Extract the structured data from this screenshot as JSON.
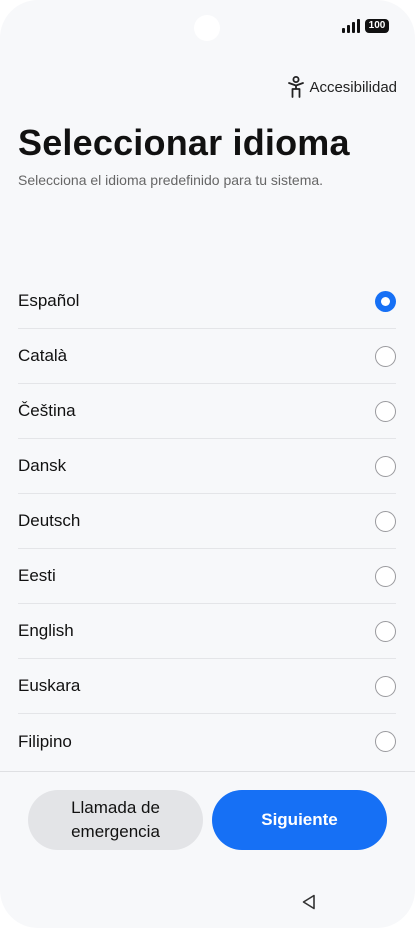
{
  "status_bar": {
    "battery_label": "100",
    "icons": [
      "camera-cutout",
      "signal-icon",
      "battery-icon"
    ]
  },
  "header": {
    "accessibility_label": "Accesibilidad",
    "accessibility_icon": "accessibility-icon"
  },
  "main": {
    "title": "Seleccionar idioma",
    "subtitle": "Selecciona el idioma predefinido para tu sistema."
  },
  "languages": [
    {
      "label": "Español",
      "selected": true
    },
    {
      "label": "Català",
      "selected": false
    },
    {
      "label": "Čeština",
      "selected": false
    },
    {
      "label": "Dansk",
      "selected": false
    },
    {
      "label": "Deutsch",
      "selected": false
    },
    {
      "label": "Eesti",
      "selected": false
    },
    {
      "label": "English",
      "selected": false
    },
    {
      "label": "Euskara",
      "selected": false
    },
    {
      "label": "Filipino",
      "selected": false
    }
  ],
  "footer": {
    "emergency_line1": "Llamada de",
    "emergency_line2": "emergencia",
    "next_label": "Siguiente"
  },
  "nav": {
    "back_icon": "back-triangle-icon"
  },
  "colors": {
    "accent": "#1670f5",
    "background": "#f7f8fa",
    "secondary_button": "#e3e4e7"
  }
}
